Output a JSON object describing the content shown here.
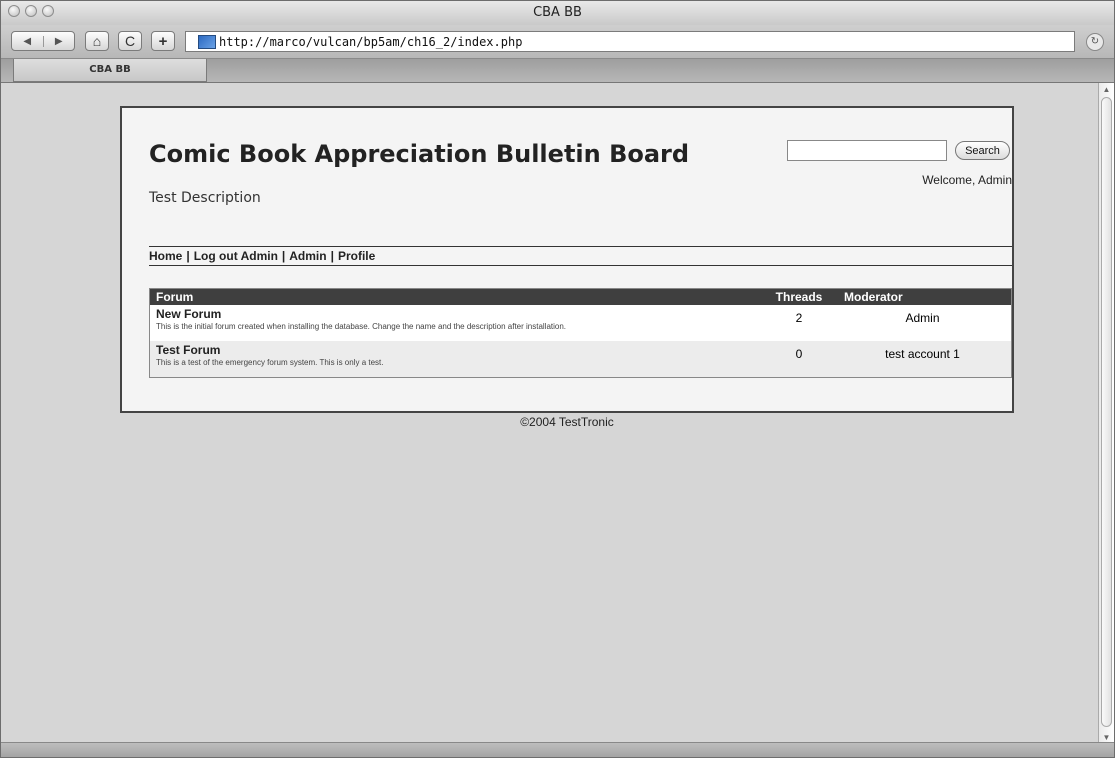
{
  "window": {
    "title": "CBA BB"
  },
  "toolbar": {
    "back_symbol": "◀",
    "forward_symbol": "▶",
    "home_symbol": "⌂",
    "reload_symbol": "C",
    "add_symbol": "+",
    "url": "http://marco/vulcan/bp5am/ch16_2/index.php"
  },
  "tabs": [
    {
      "label": "CBA BB"
    }
  ],
  "header": {
    "board_title": "Comic Book Appreciation Bulletin Board",
    "description": "Test Description",
    "search_input_value": "",
    "search_button_label": "Search",
    "welcome_text": "Welcome, Admin"
  },
  "nav": {
    "links": [
      "Home",
      "Log out Admin",
      "Admin",
      "Profile"
    ],
    "separator": "|"
  },
  "forums_table": {
    "headers": {
      "forum": "Forum",
      "threads": "Threads",
      "moderator": "Moderator"
    },
    "rows": [
      {
        "name": "New Forum",
        "description": "This is the initial forum created when installing the database. Change the name and the description after installation.",
        "threads": "2",
        "moderator": "Admin"
      },
      {
        "name": "Test Forum",
        "description": "This is a test of the emergency forum system. This is only a test.",
        "threads": "0",
        "moderator": "test account 1"
      }
    ]
  },
  "footer": {
    "text": "©2004 TestTronic"
  }
}
